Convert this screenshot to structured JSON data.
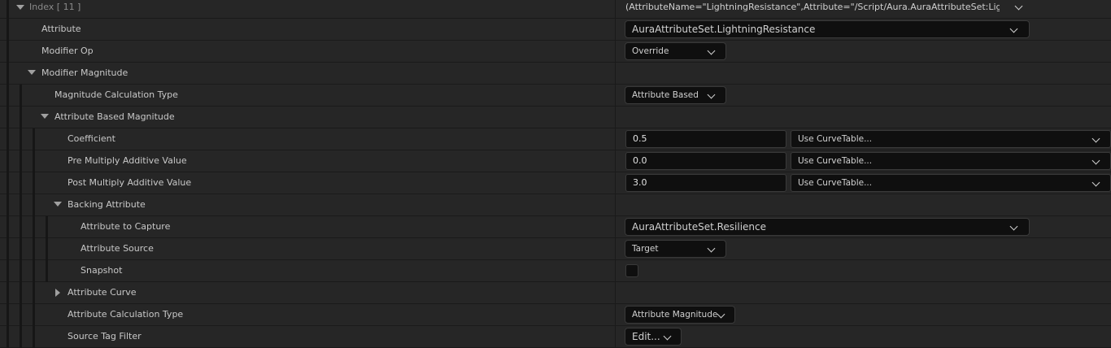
{
  "rows": {
    "index": {
      "label": "Index [ 11 ]",
      "value": "(AttributeName=\"LightningResistance\",Attribute=\"/Script/Aura.AuraAttributeSet:LightningRe"
    },
    "attribute": {
      "label": "Attribute",
      "value": "AuraAttributeSet.LightningResistance"
    },
    "modifier_op": {
      "label": "Modifier Op",
      "value": "Override"
    },
    "modifier_magnitude": {
      "label": "Modifier Magnitude"
    },
    "magnitude_calc_type": {
      "label": "Magnitude Calculation Type",
      "value": "Attribute Based"
    },
    "attribute_based_magnitude": {
      "label": "Attribute Based Magnitude"
    },
    "coefficient": {
      "label": "Coefficient",
      "value": "0.5",
      "curve": "Use CurveTable..."
    },
    "pre_multiply": {
      "label": "Pre Multiply Additive Value",
      "value": "0.0",
      "curve": "Use CurveTable..."
    },
    "post_multiply": {
      "label": "Post Multiply Additive Value",
      "value": "3.0",
      "curve": "Use CurveTable..."
    },
    "backing_attribute": {
      "label": "Backing Attribute"
    },
    "attribute_to_capture": {
      "label": "Attribute to Capture",
      "value": "AuraAttributeSet.Resilience"
    },
    "attribute_source": {
      "label": "Attribute Source",
      "value": "Target"
    },
    "snapshot": {
      "label": "Snapshot",
      "checked": false
    },
    "attribute_curve": {
      "label": "Attribute Curve"
    },
    "attribute_calc_type": {
      "label": "Attribute Calculation Type",
      "value": "Attribute Magnitude"
    },
    "source_tag_filter": {
      "label": "Source Tag Filter",
      "value": "Edit..."
    }
  },
  "colors": {
    "row_bg": "#262626",
    "field_bg": "#0f0f0f",
    "text": "#c8c8c8"
  }
}
